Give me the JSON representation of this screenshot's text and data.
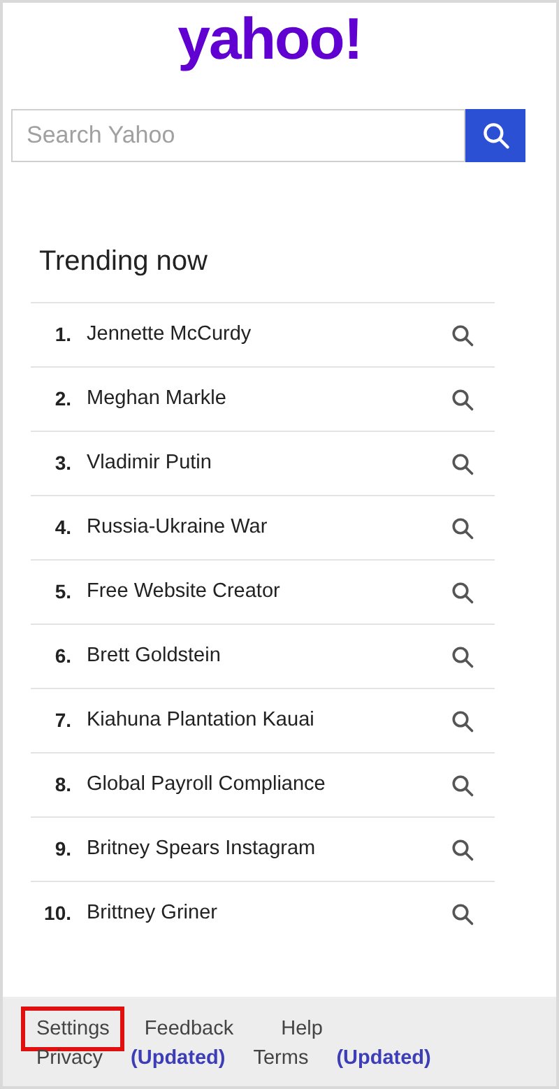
{
  "logo": "yahoo!",
  "search": {
    "placeholder": "Search Yahoo"
  },
  "trending": {
    "title": "Trending now",
    "items": [
      {
        "rank": "1.",
        "label": "Jennette McCurdy"
      },
      {
        "rank": "2.",
        "label": "Meghan Markle"
      },
      {
        "rank": "3.",
        "label": "Vladimir Putin"
      },
      {
        "rank": "4.",
        "label": "Russia-Ukraine War"
      },
      {
        "rank": "5.",
        "label": "Free Website Creator"
      },
      {
        "rank": "6.",
        "label": "Brett Goldstein"
      },
      {
        "rank": "7.",
        "label": "Kiahuna Plantation Kauai"
      },
      {
        "rank": "8.",
        "label": "Global Payroll Compliance"
      },
      {
        "rank": "9.",
        "label": "Britney Spears Instagram"
      },
      {
        "rank": "10.",
        "label": "Brittney Griner"
      }
    ]
  },
  "footer": {
    "row_1": [
      {
        "label": "Settings",
        "highlighted": true
      },
      {
        "label": "Feedback",
        "highlighted": false
      },
      {
        "label": "Help",
        "highlighted": false
      }
    ],
    "row_2": [
      {
        "label": "Privacy",
        "kind": "link"
      },
      {
        "label": "(Updated)",
        "kind": "badge"
      },
      {
        "label": "Terms",
        "kind": "link"
      },
      {
        "label": "(Updated)",
        "kind": "badge"
      }
    ]
  }
}
